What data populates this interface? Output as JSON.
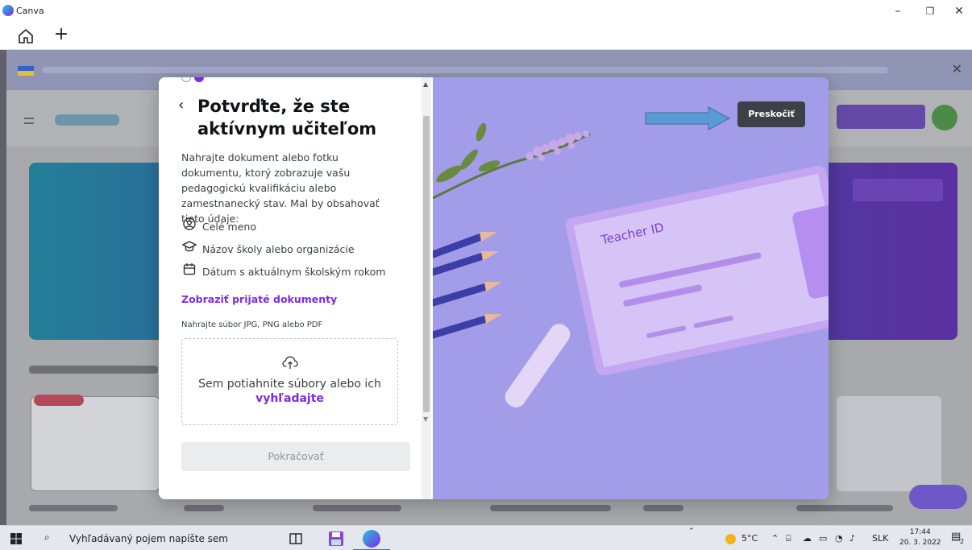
{
  "window": {
    "title": "Canva",
    "controls": [
      "–",
      "❐",
      "✕"
    ]
  },
  "tabs": {
    "home_icon": "home-icon",
    "add_label": "+"
  },
  "modal": {
    "title": "Potvrďte, že ste aktívnym učiteľom",
    "description": "Nahrajte dokument alebo fotku dokumentu, ktorý zobrazuje vašu pedagogickú kvalifikáciu alebo zamestnanecký stav. Mal by obsahovať tieto údaje:",
    "requirements": [
      {
        "icon": "person-circle-icon",
        "glyph": "Ⓐ",
        "label": "Celé meno"
      },
      {
        "icon": "graduation-cap-icon",
        "glyph": "🎓",
        "label": "Názov školy alebo organizácie"
      },
      {
        "icon": "calendar-icon",
        "glyph": "📅",
        "label": "Dátum s aktuálnym školským rokom"
      }
    ],
    "accepted_docs_link": "Zobraziť prijaté dokumenty",
    "upload_hint": "Nahrajte súbor JPG, PNG alebo PDF",
    "dropzone_text": "Sem potiahnite súbory alebo ich",
    "dropzone_link": "vyhľadajte",
    "continue_label": "Pokračovať",
    "skip_label": "Preskočiť",
    "card_title": "Teacher ID"
  },
  "taskbar": {
    "search_placeholder": "Vyhľadávaný pojem napíšte sem",
    "weather": "5°C",
    "language": "SLK",
    "time": "17:44",
    "date": "20. 3. 2022",
    "notification_count": "2"
  },
  "colors": {
    "accent": "#7d2ae8",
    "skip_bg": "#3d4047",
    "arrow": "#5b9bd5",
    "illustration_bg": "#a39ce8"
  }
}
